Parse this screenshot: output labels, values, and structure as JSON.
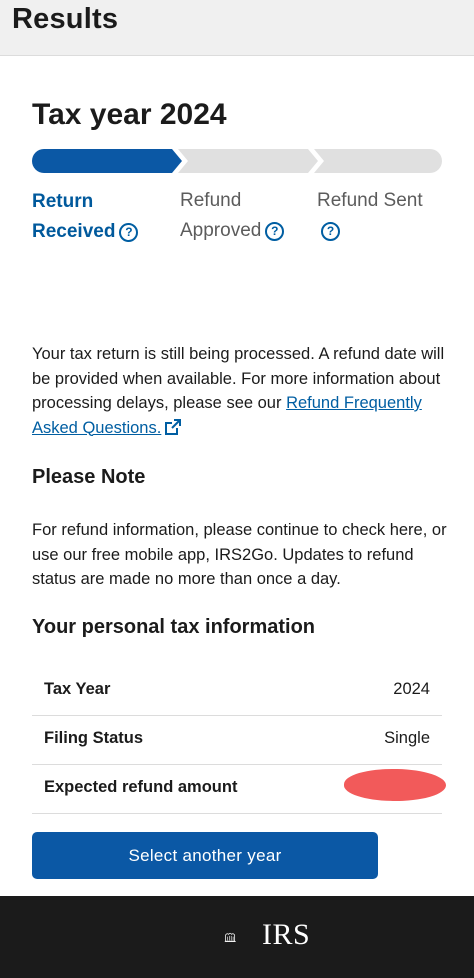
{
  "header": {
    "title": "Results"
  },
  "tax_year_title": "Tax year 2024",
  "tracker": {
    "active_color": "#0b58a5",
    "inactive_color": "#e0e0e0",
    "steps": [
      {
        "line1": "Return",
        "line2": "Received",
        "state": "active"
      },
      {
        "line1": "Refund",
        "line2": "Approved",
        "state": "inactive"
      },
      {
        "line1": "Refund Sent",
        "line2": "",
        "state": "inactive"
      }
    ],
    "help_glyph": "?"
  },
  "status_message": {
    "text": "Your tax return is still being processed. A refund date will be provided when available. For more information about processing delays, please see our ",
    "link_text": "Refund Frequently Asked Questions.",
    "link_icon": "external-link-icon"
  },
  "note": {
    "heading": "Please Note",
    "text": "For refund information, please continue to check here, or use our free mobile app, IRS2Go. Updates to refund status are made no more than once a day."
  },
  "personal_info": {
    "heading": "Your personal tax information",
    "rows": [
      {
        "label": "Tax Year",
        "value": "2024"
      },
      {
        "label": "Filing Status",
        "value": "Single"
      },
      {
        "label": "Expected refund amount",
        "value": ""
      }
    ],
    "redaction_color": "#f25a5a"
  },
  "select_button": {
    "label": "Select another year",
    "color": "#0b58a5"
  },
  "footer": {
    "logo_text": "IRS",
    "logo_icon": "irs-eagle-logo-icon"
  }
}
